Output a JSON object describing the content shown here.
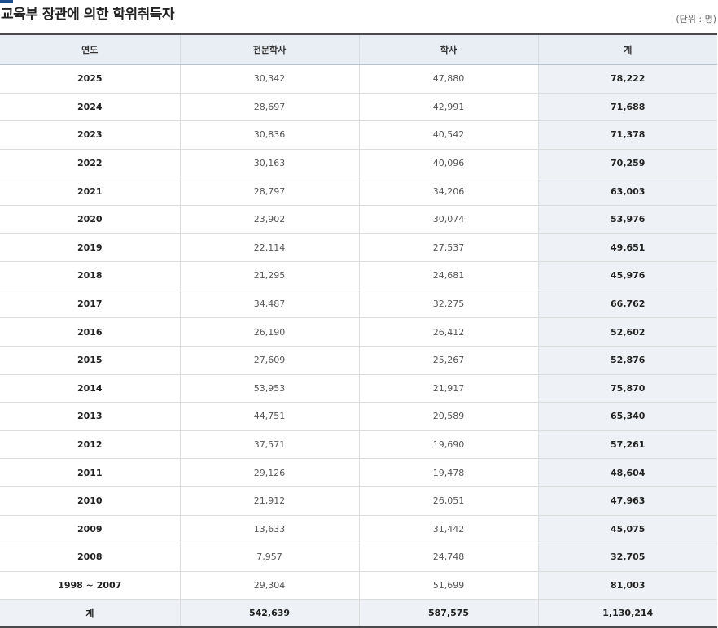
{
  "title": "교육부 장관에 의한 학위취득자",
  "unit": "(단위 : 명)",
  "colors": {
    "accent": "#1f4e8c",
    "header_bg": "#e8eef4",
    "total_bg": "#eef2f6"
  },
  "table": {
    "headers": [
      "연도",
      "전문학사",
      "학사",
      "계"
    ],
    "rows": [
      {
        "year": "2025",
        "associate": "30,342",
        "bachelor": "47,880",
        "total": "78,222"
      },
      {
        "year": "2024",
        "associate": "28,697",
        "bachelor": "42,991",
        "total": "71,688"
      },
      {
        "year": "2023",
        "associate": "30,836",
        "bachelor": "40,542",
        "total": "71,378"
      },
      {
        "year": "2022",
        "associate": "30,163",
        "bachelor": "40,096",
        "total": "70,259"
      },
      {
        "year": "2021",
        "associate": "28,797",
        "bachelor": "34,206",
        "total": "63,003"
      },
      {
        "year": "2020",
        "associate": "23,902",
        "bachelor": "30,074",
        "total": "53,976"
      },
      {
        "year": "2019",
        "associate": "22,114",
        "bachelor": "27,537",
        "total": "49,651"
      },
      {
        "year": "2018",
        "associate": "21,295",
        "bachelor": "24,681",
        "total": "45,976"
      },
      {
        "year": "2017",
        "associate": "34,487",
        "bachelor": "32,275",
        "total": "66,762"
      },
      {
        "year": "2016",
        "associate": "26,190",
        "bachelor": "26,412",
        "total": "52,602"
      },
      {
        "year": "2015",
        "associate": "27,609",
        "bachelor": "25,267",
        "total": "52,876"
      },
      {
        "year": "2014",
        "associate": "53,953",
        "bachelor": "21,917",
        "total": "75,870"
      },
      {
        "year": "2013",
        "associate": "44,751",
        "bachelor": "20,589",
        "total": "65,340"
      },
      {
        "year": "2012",
        "associate": "37,571",
        "bachelor": "19,690",
        "total": "57,261"
      },
      {
        "year": "2011",
        "associate": "29,126",
        "bachelor": "19,478",
        "total": "48,604"
      },
      {
        "year": "2010",
        "associate": "21,912",
        "bachelor": "26,051",
        "total": "47,963"
      },
      {
        "year": "2009",
        "associate": "13,633",
        "bachelor": "31,442",
        "total": "45,075"
      },
      {
        "year": "2008",
        "associate": "7,957",
        "bachelor": "24,748",
        "total": "32,705"
      },
      {
        "year": "1998 ~ 2007",
        "associate": "29,304",
        "bachelor": "51,699",
        "total": "81,003"
      }
    ],
    "sum": {
      "label": "계",
      "associate": "542,639",
      "bachelor": "587,575",
      "total": "1,130,214"
    }
  }
}
